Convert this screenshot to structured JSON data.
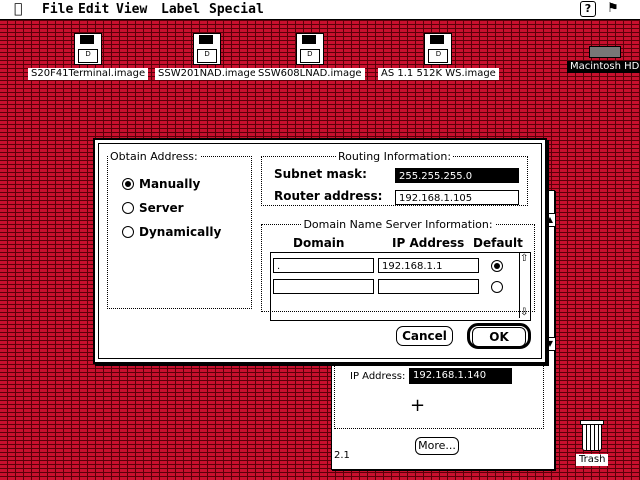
{
  "menubar": {
    "apple": "",
    "items": [
      "File",
      "Edit",
      "View",
      "Label",
      "Special"
    ],
    "help": "?",
    "app_icon": "⚑"
  },
  "desktop": {
    "icons": [
      {
        "label": "S20F41Terminal.image"
      },
      {
        "label": "SSW201NAD.image"
      },
      {
        "label": "SSW608LNAD.image"
      },
      {
        "label": "AS 1.1 512K WS.image"
      }
    ],
    "disk_glyph": "D",
    "hard_drive": {
      "label": "Macintosh HD"
    },
    "trash": {
      "label": "Trash"
    }
  },
  "background_window": {
    "ip_label": "IP Address:",
    "ip_value": "192.168.1.140",
    "more_button": "More...",
    "version": "2.1",
    "cross": "+"
  },
  "dialog": {
    "obtain": {
      "legend": "Obtain Address:",
      "options": [
        {
          "label": "Manually",
          "selected": true
        },
        {
          "label": "Server",
          "selected": false
        },
        {
          "label": "Dynamically",
          "selected": false
        }
      ]
    },
    "routing": {
      "legend": "Routing Information:",
      "subnet_label": "Subnet mask:",
      "subnet_value": "255.255.255.0",
      "router_label": "Router address:",
      "router_value": "192.168.1.105"
    },
    "dns": {
      "legend": "Domain Name Server Information:",
      "headers": {
        "domain": "Domain",
        "ip": "IP Address",
        "default": "Default"
      },
      "rows": [
        {
          "domain": ".",
          "ip": "192.168.1.1",
          "default": true
        },
        {
          "domain": "",
          "ip": "",
          "default": false
        }
      ],
      "scroll_up": "⇧",
      "scroll_down": "⇩"
    },
    "cancel_button": "Cancel",
    "ok_button": "OK"
  }
}
